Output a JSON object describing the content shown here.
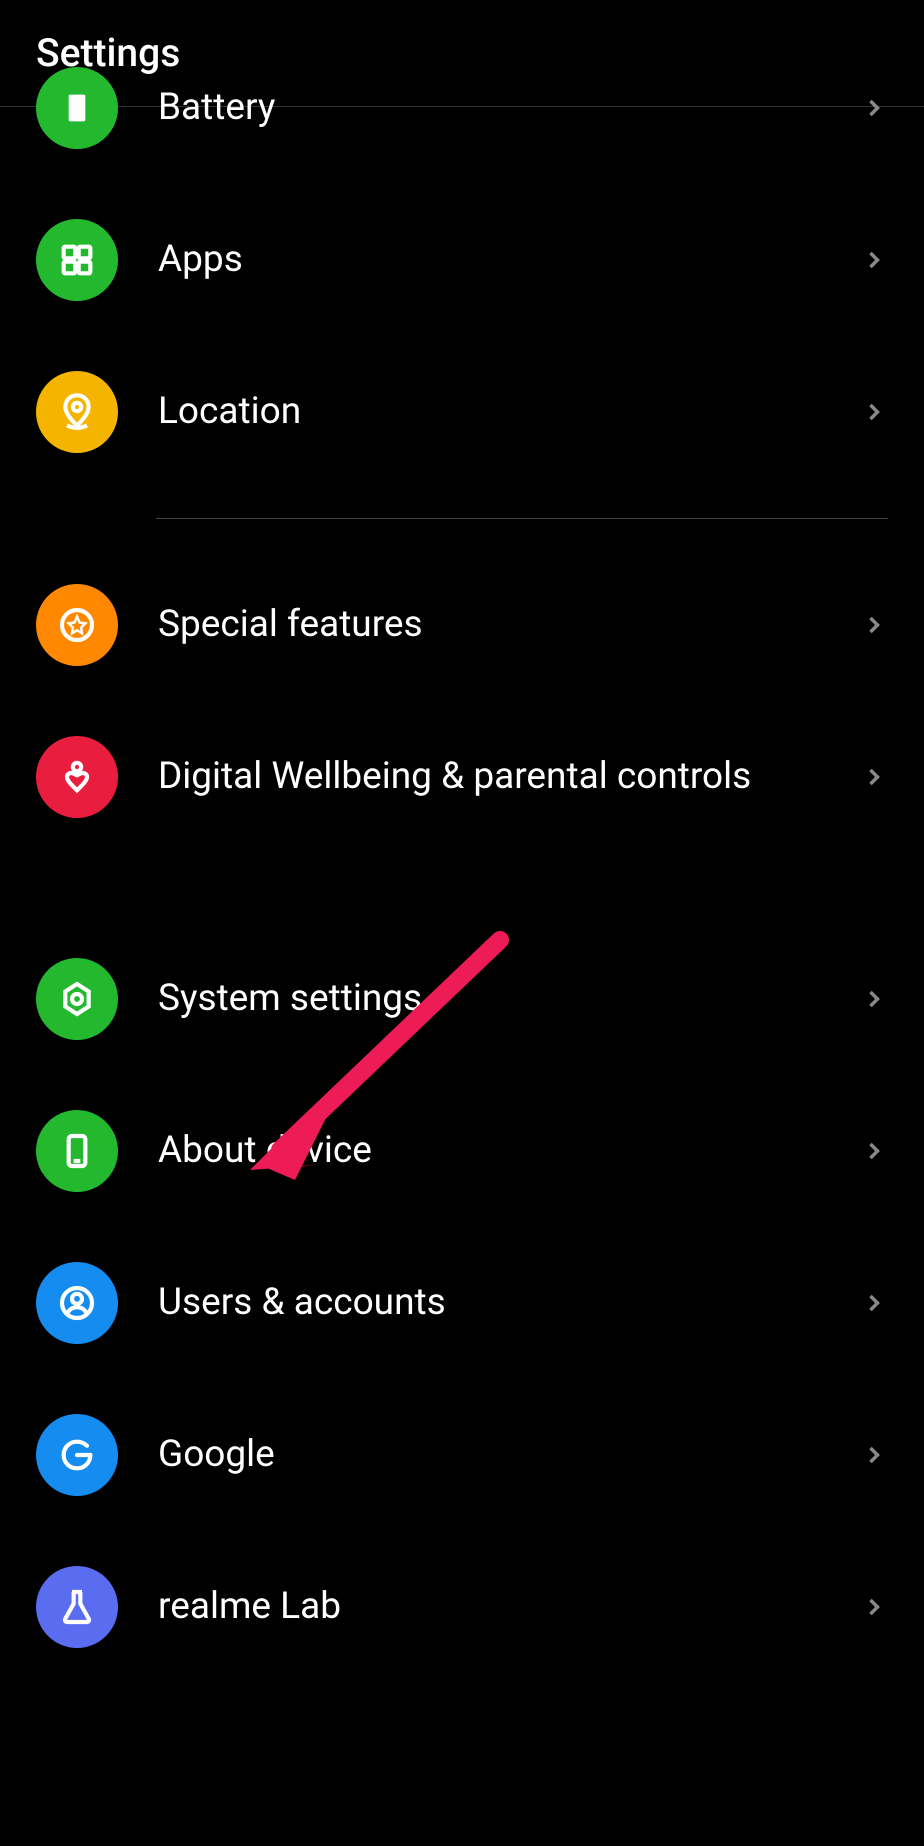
{
  "header": {
    "title": "Settings"
  },
  "items": {
    "battery": {
      "label": "Battery"
    },
    "apps": {
      "label": "Apps"
    },
    "location": {
      "label": "Location"
    },
    "special_features": {
      "label": "Special features"
    },
    "digital_wellbeing": {
      "label": "Digital Wellbeing & parental controls"
    },
    "system_settings": {
      "label": "System settings"
    },
    "about_device": {
      "label": "About device"
    },
    "users_accounts": {
      "label": "Users & accounts"
    },
    "google": {
      "label": "Google"
    },
    "realme_lab": {
      "label": "realme Lab"
    }
  },
  "colors": {
    "green": "#23b82e",
    "yellow": "#f4b400",
    "orange": "#ff8800",
    "red": "#e91e3f",
    "blue": "#148cf0",
    "purple": "#5a6cf0",
    "arrow": "#ed1b56"
  }
}
